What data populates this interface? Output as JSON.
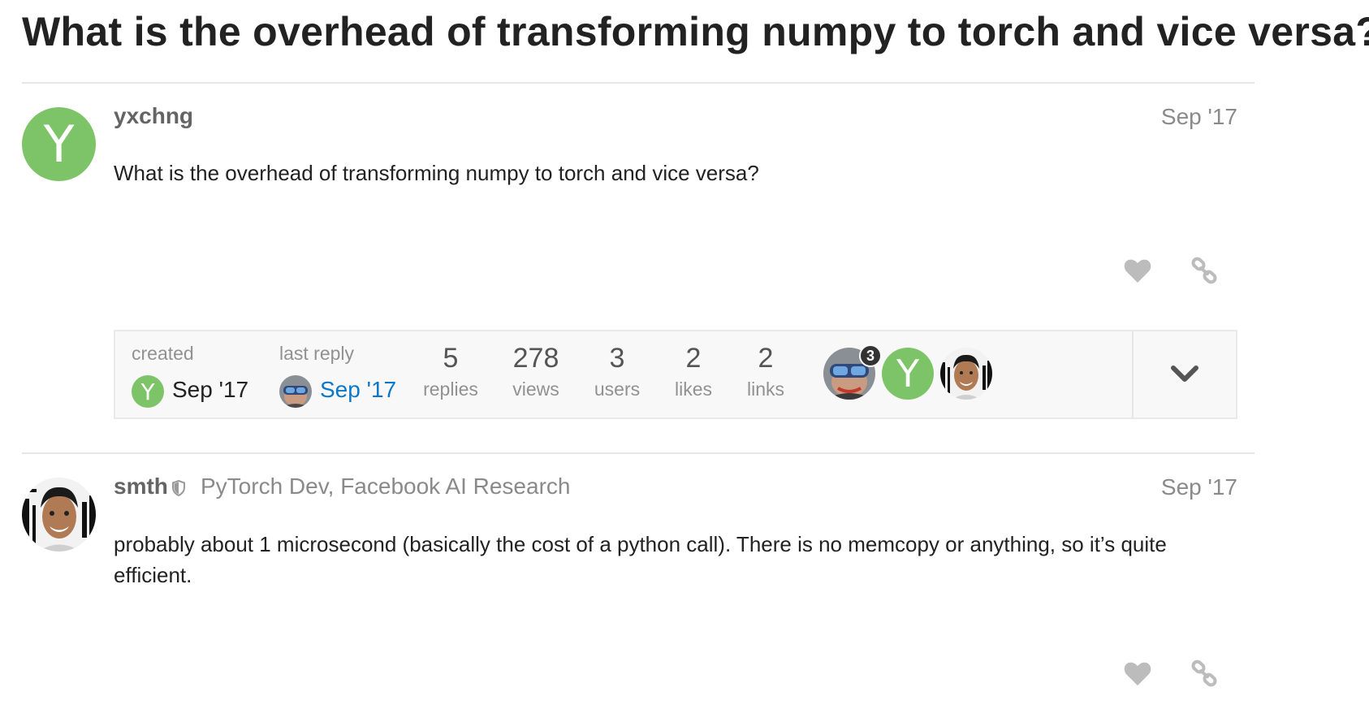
{
  "topic": {
    "title": "What is the overhead of transforming numpy to torch and vice versa?"
  },
  "posts": [
    {
      "username": "yxchng",
      "avatar_letter": "Y",
      "date": "Sep '17",
      "body": "What is the overhead of transforming numpy to torch and vice versa?",
      "actions": [
        "heart-icon",
        "link-icon"
      ]
    },
    {
      "username": "smth",
      "user_title": "PyTorch Dev, Facebook AI Research",
      "moderator_icon": "shield-icon",
      "date": "Sep '17",
      "body": "probably about 1 microsecond (basically the cost of a python call). There is no memcopy or anything, so it’s quite efficient.",
      "actions": [
        "heart-icon",
        "link-icon"
      ]
    }
  ],
  "topic_map": {
    "created_label": "created",
    "created_date": "Sep '17",
    "created_avatar_letter": "Y",
    "last_reply_label": "last reply",
    "last_reply_date": "Sep '17",
    "stats": [
      {
        "value": "5",
        "label": "replies"
      },
      {
        "value": "278",
        "label": "views"
      },
      {
        "value": "3",
        "label": "users"
      },
      {
        "value": "2",
        "label": "likes"
      },
      {
        "value": "2",
        "label": "links"
      }
    ],
    "participants": [
      {
        "avatar": "goggles-avatar",
        "count": "3"
      },
      {
        "avatar": "letter-avatar",
        "letter": "Y"
      },
      {
        "avatar": "smth-avatar"
      }
    ],
    "expand_icon": "chevron-down-icon"
  },
  "colors": {
    "avatar_green": "#7dc468",
    "link_blue": "#0a78c8",
    "muted_text": "#8a8a8a",
    "icon_gray": "#bcbcbc"
  }
}
